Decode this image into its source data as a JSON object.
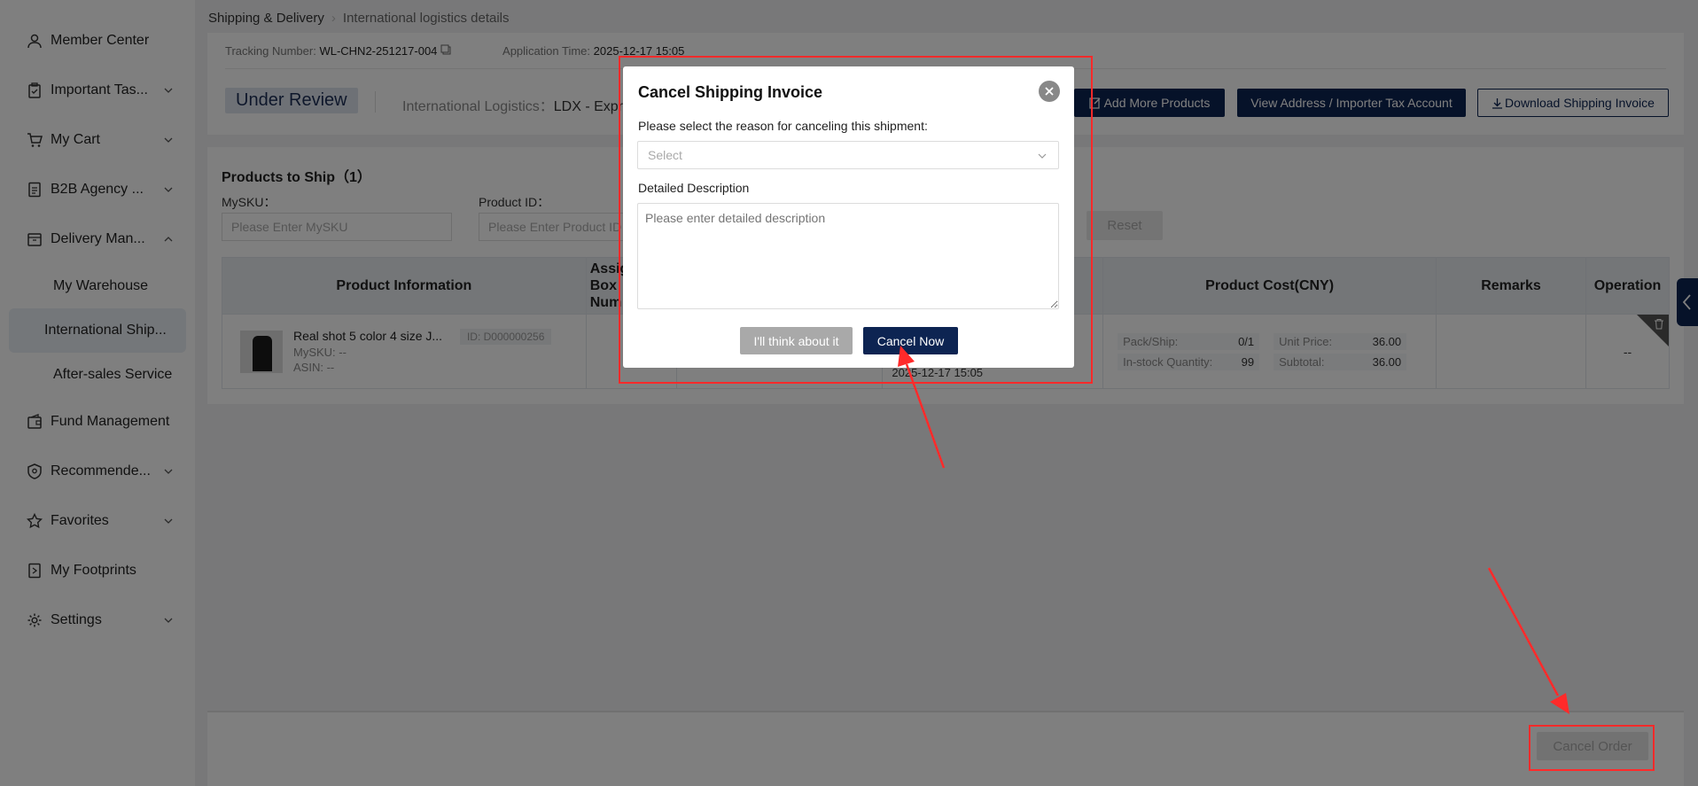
{
  "sidebar": {
    "items": [
      {
        "label": "Member Center",
        "icon": "user-icon",
        "expandable": false
      },
      {
        "label": "Important Tas...",
        "icon": "clipboard-icon",
        "expandable": true
      },
      {
        "label": "My Cart",
        "icon": "cart-icon",
        "expandable": true
      },
      {
        "label": "B2B Agency ...",
        "icon": "document-icon",
        "expandable": true
      },
      {
        "label": "Delivery Man...",
        "icon": "box-icon",
        "expandable": true,
        "expanded": true
      },
      {
        "label": "Fund Management",
        "icon": "wallet-icon",
        "expandable": false
      },
      {
        "label": "Recommende...",
        "icon": "shield-icon",
        "expandable": true
      },
      {
        "label": "Favorites",
        "icon": "star-icon",
        "expandable": true
      },
      {
        "label": "My Footprints",
        "icon": "footprint-icon",
        "expandable": false
      },
      {
        "label": "Settings",
        "icon": "gear-icon",
        "expandable": true
      }
    ],
    "sub_items": [
      {
        "label": "My Warehouse",
        "active": false
      },
      {
        "label": "International Ship...",
        "active": true
      },
      {
        "label": "After-sales Service",
        "active": false
      }
    ]
  },
  "breadcrumb": {
    "parent": "Shipping & Delivery",
    "current": "International logistics details"
  },
  "info": {
    "tracking_label": "Tracking Number:",
    "tracking_value": "WL-CHN2-251217-004",
    "application_label": "Application Time:",
    "application_value": "2025-12-17 15:05",
    "status": "Under Review",
    "logistics_label": "International Logistics：",
    "logistics_value": "LDX - Expre"
  },
  "actions": {
    "add_products": "Add More Products",
    "view_address": "View Address / Importer Tax Account",
    "download_invoice": "Download Shipping Invoice"
  },
  "products": {
    "title": "Products to Ship（1）",
    "filters": {
      "mysku_label": "MySKU：",
      "mysku_placeholder": "Please Enter MySKU",
      "product_id_label": "Product ID：",
      "product_id_placeholder": "Please Enter Product ID",
      "reset": "Reset"
    },
    "columns": {
      "product_info": "Product Information",
      "assigned": "Assig",
      "assigned_2": "Box",
      "assigned_3": "Num",
      "product_cost": "Product Cost(CNY)",
      "remarks": "Remarks",
      "operation": "Operation"
    },
    "row": {
      "name": "Real shot 5 color 4 size J...",
      "id": "ID: D000000256",
      "mysku": "MySKU: --",
      "asin": "ASIN: --",
      "time": "2025-12-17 15:05",
      "pack_label": "Pack/Ship:",
      "pack_value": "0/1",
      "unit_price_label": "Unit Price:",
      "unit_price_value": "36.00",
      "stock_label": "In-stock Quantity:",
      "stock_value": "99",
      "subtotal_label": "Subtotal:",
      "subtotal_value": "36.00",
      "operation": "--"
    }
  },
  "footer": {
    "cancel_order": "Cancel Order"
  },
  "modal": {
    "title": "Cancel Shipping Invoice",
    "reason_label": "Please select the reason for canceling this shipment:",
    "select_placeholder": "Select",
    "description_label": "Detailed Description",
    "description_placeholder": "Please enter detailed description",
    "think_button": "I'll think about it",
    "cancel_now_button": "Cancel Now"
  },
  "colors": {
    "brand_navy": "#0d2452",
    "annotation_red": "#ff2a2a"
  }
}
